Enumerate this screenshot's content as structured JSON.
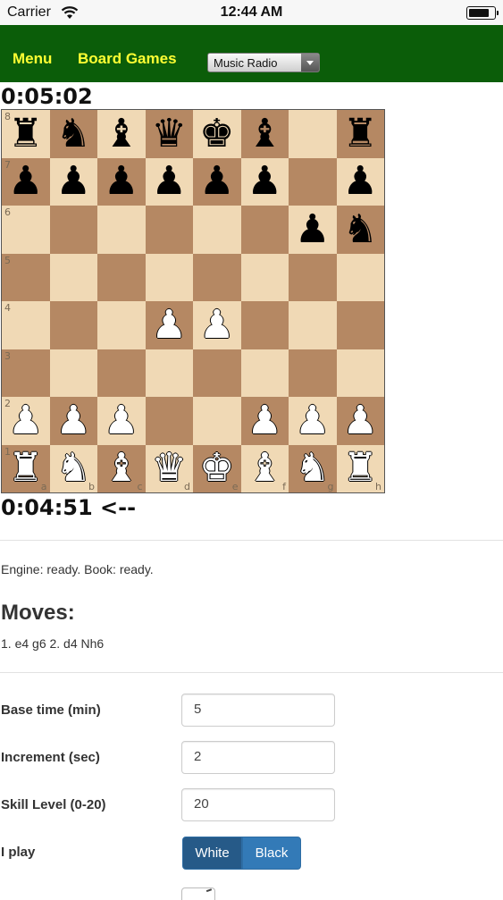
{
  "status_bar": {
    "carrier": "Carrier",
    "time": "12:44 AM"
  },
  "nav": {
    "menu_label": "Menu",
    "board_games_label": "Board Games",
    "radio_select_value": "Music Radio"
  },
  "clocks": {
    "top": "0:05:02",
    "bottom": "0:04:51 <--"
  },
  "board": {
    "ranks": [
      "8",
      "7",
      "6",
      "5",
      "4",
      "3",
      "2",
      "1"
    ],
    "files": [
      "a",
      "b",
      "c",
      "d",
      "e",
      "f",
      "g",
      "h"
    ],
    "rows": [
      [
        "bR",
        "bN",
        "bB",
        "bQ",
        "bK",
        "bB",
        "",
        ""
      ],
      [
        "bP",
        "bP",
        "bP",
        "bP",
        "bP",
        "bP",
        "",
        "bP"
      ],
      [
        "",
        "",
        "",
        "",
        "",
        "",
        "bP",
        "bN"
      ],
      [
        "",
        "",
        "",
        "",
        "",
        "",
        "",
        ""
      ],
      [
        "",
        "",
        "",
        "wP",
        "wP",
        "",
        "",
        ""
      ],
      [
        "",
        "",
        "",
        "",
        "",
        "",
        "",
        ""
      ],
      [
        "wP",
        "wP",
        "wP",
        "",
        "",
        "wP",
        "wP",
        "wP"
      ],
      [
        "wR",
        "wN",
        "wB",
        "wQ",
        "wK",
        "wB",
        "wN",
        "wR"
      ]
    ],
    "corner_rook": {
      "row": 0,
      "col": 7,
      "piece": "bR"
    },
    "colors": {
      "light": "#f0d9b5",
      "dark": "#b58863"
    }
  },
  "status": "Engine: ready. Book: ready.",
  "moves": {
    "heading": "Moves:",
    "text": "1. e4 g6 2. d4 Nh6"
  },
  "form": {
    "base_time_label": "Base time (min)",
    "base_time_value": "5",
    "increment_label": "Increment (sec)",
    "increment_value": "2",
    "skill_label": "Skill Level (0-20)",
    "skill_value": "20",
    "play_label": "I play",
    "play_white": "White",
    "play_black": "Black"
  },
  "colors": {
    "nav_bg": "#0b5d09",
    "nav_link": "#ffff33",
    "btn_primary": "#337ab7",
    "btn_active": "#265a88"
  }
}
